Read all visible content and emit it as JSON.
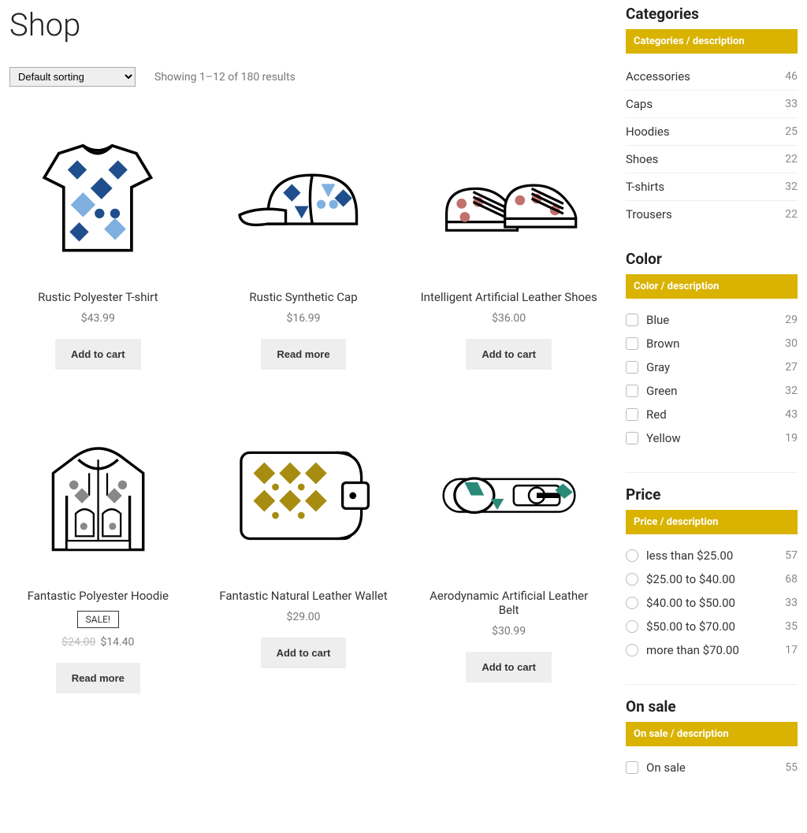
{
  "shop": {
    "title": "Shop",
    "sort_selected": "Default sorting",
    "result_count": "Showing 1–12 of 180 results"
  },
  "buttons": {
    "add_to_cart": "Add to cart",
    "read_more": "Read more"
  },
  "sale_label": "SALE!",
  "products": [
    {
      "name": "Rustic Polyester T-shirt",
      "price": "$43.99",
      "btn": "add",
      "img": "tshirt"
    },
    {
      "name": "Rustic Synthetic Cap",
      "price": "$16.99",
      "btn": "read",
      "img": "cap"
    },
    {
      "name": "Intelligent Artificial Leather Shoes",
      "price": "$36.00",
      "btn": "add",
      "img": "shoes"
    },
    {
      "name": "Fantastic Polyester Hoodie",
      "price": "$14.40",
      "old_price": "$24.00",
      "sale": true,
      "btn": "read",
      "img": "hoodie"
    },
    {
      "name": "Fantastic Natural Leather Wallet",
      "price": "$29.00",
      "btn": "add",
      "img": "wallet"
    },
    {
      "name": "Aerodynamic Artificial Leather Belt",
      "price": "$30.99",
      "btn": "add",
      "img": "belt"
    }
  ],
  "sidebar": {
    "categories": {
      "title": "Categories",
      "desc": "Categories / description",
      "items": [
        {
          "label": "Accessories",
          "count": 46
        },
        {
          "label": "Caps",
          "count": 33
        },
        {
          "label": "Hoodies",
          "count": 25
        },
        {
          "label": "Shoes",
          "count": 22
        },
        {
          "label": "T-shirts",
          "count": 32
        },
        {
          "label": "Trousers",
          "count": 22
        }
      ]
    },
    "color": {
      "title": "Color",
      "desc": "Color / description",
      "items": [
        {
          "label": "Blue",
          "count": 29
        },
        {
          "label": "Brown",
          "count": 30
        },
        {
          "label": "Gray",
          "count": 27
        },
        {
          "label": "Green",
          "count": 32
        },
        {
          "label": "Red",
          "count": 43
        },
        {
          "label": "Yellow",
          "count": 19
        }
      ]
    },
    "price": {
      "title": "Price",
      "desc": "Price / description",
      "items": [
        {
          "label": "less than $25.00",
          "count": 57
        },
        {
          "label": "$25.00 to $40.00",
          "count": 68
        },
        {
          "label": "$40.00 to $50.00",
          "count": 33
        },
        {
          "label": "$50.00 to $70.00",
          "count": 35
        },
        {
          "label": "more than $70.00",
          "count": 17
        }
      ]
    },
    "onsale": {
      "title": "On sale",
      "desc": "On sale / description",
      "items": [
        {
          "label": "On sale",
          "count": 55
        }
      ]
    }
  }
}
